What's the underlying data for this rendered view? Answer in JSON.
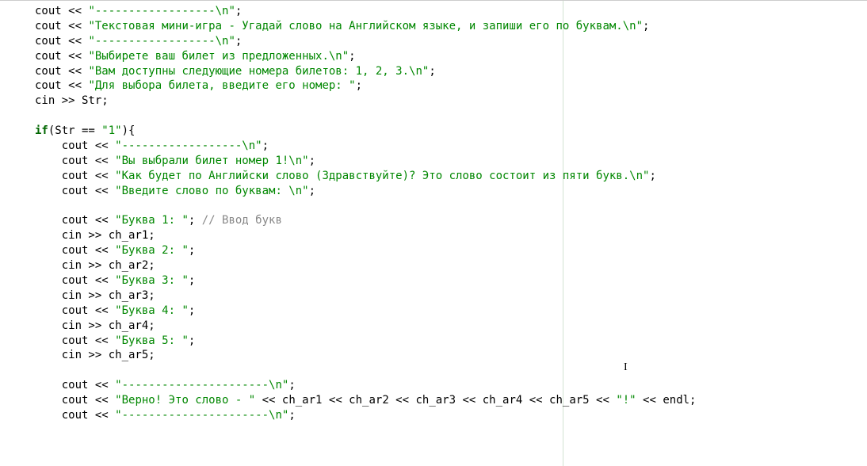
{
  "tokens": [
    [
      [
        "id",
        "cout << "
      ],
      [
        "str",
        "\"------------------\\n\""
      ],
      [
        "id",
        ";"
      ]
    ],
    [
      [
        "id",
        "cout << "
      ],
      [
        "str",
        "\"Текстовая мини-игра - Угадай слово на Английском языке, и запиши его по буквам.\\n\""
      ],
      [
        "id",
        ";"
      ]
    ],
    [
      [
        "id",
        "cout << "
      ],
      [
        "str",
        "\"------------------\\n\""
      ],
      [
        "id",
        ";"
      ]
    ],
    [
      [
        "id",
        "cout << "
      ],
      [
        "str",
        "\"Выбирете ваш билет из предложенных.\\n\""
      ],
      [
        "id",
        ";"
      ]
    ],
    [
      [
        "id",
        "cout << "
      ],
      [
        "str",
        "\"Вам доступны следующие номера билетов: 1, 2, 3.\\n\""
      ],
      [
        "id",
        ";"
      ]
    ],
    [
      [
        "id",
        "cout << "
      ],
      [
        "str",
        "\"Для выбора билета, введите его номер: \""
      ],
      [
        "id",
        ";"
      ]
    ],
    [
      [
        "id",
        "cin >> Str;"
      ]
    ],
    [],
    [
      [
        "kw",
        "if"
      ],
      [
        "id",
        "(Str == "
      ],
      [
        "str",
        "\"1\""
      ],
      [
        "id",
        "){"
      ]
    ],
    [
      [
        "id",
        "    cout << "
      ],
      [
        "str",
        "\"------------------\\n\""
      ],
      [
        "id",
        ";"
      ]
    ],
    [
      [
        "id",
        "    cout << "
      ],
      [
        "str",
        "\"Вы выбрали билет номер 1!\\n\""
      ],
      [
        "id",
        ";"
      ]
    ],
    [
      [
        "id",
        "    cout << "
      ],
      [
        "str",
        "\"Как будет по Английски слово (Здравствуйте)? Это слово состоит из пяти букв.\\n\""
      ],
      [
        "id",
        ";"
      ]
    ],
    [
      [
        "id",
        "    cout << "
      ],
      [
        "str",
        "\"Введите слово по буквам: \\n\""
      ],
      [
        "id",
        ";"
      ]
    ],
    [],
    [
      [
        "id",
        "    cout << "
      ],
      [
        "str",
        "\"Буква 1: \""
      ],
      [
        "id",
        "; "
      ],
      [
        "cmt",
        "// Ввод букв"
      ]
    ],
    [
      [
        "id",
        "    cin >> ch_ar1;"
      ]
    ],
    [
      [
        "id",
        "    cout << "
      ],
      [
        "str",
        "\"Буква 2: \""
      ],
      [
        "id",
        ";"
      ]
    ],
    [
      [
        "id",
        "    cin >> ch_ar2;"
      ]
    ],
    [
      [
        "id",
        "    cout << "
      ],
      [
        "str",
        "\"Буква 3: \""
      ],
      [
        "id",
        ";"
      ]
    ],
    [
      [
        "id",
        "    cin >> ch_ar3;"
      ]
    ],
    [
      [
        "id",
        "    cout << "
      ],
      [
        "str",
        "\"Буква 4: \""
      ],
      [
        "id",
        ";"
      ]
    ],
    [
      [
        "id",
        "    cin >> ch_ar4;"
      ]
    ],
    [
      [
        "id",
        "    cout << "
      ],
      [
        "str",
        "\"Буква 5: \""
      ],
      [
        "id",
        ";"
      ]
    ],
    [
      [
        "id",
        "    cin >> ch_ar5;"
      ]
    ],
    [],
    [
      [
        "id",
        "    cout << "
      ],
      [
        "str",
        "\"----------------------\\n\""
      ],
      [
        "id",
        ";"
      ]
    ],
    [
      [
        "id",
        "    cout << "
      ],
      [
        "str",
        "\"Верно! Это слово - \""
      ],
      [
        "id",
        " << ch_ar1 << ch_ar2 << ch_ar3 << ch_ar4 << ch_ar5 << "
      ],
      [
        "str",
        "\"!\""
      ],
      [
        "id",
        " << endl;"
      ]
    ],
    [
      [
        "id",
        "    cout << "
      ],
      [
        "str",
        "\"----------------------\\n\""
      ],
      [
        "id",
        ";"
      ]
    ]
  ],
  "cursor_glyph": "I"
}
